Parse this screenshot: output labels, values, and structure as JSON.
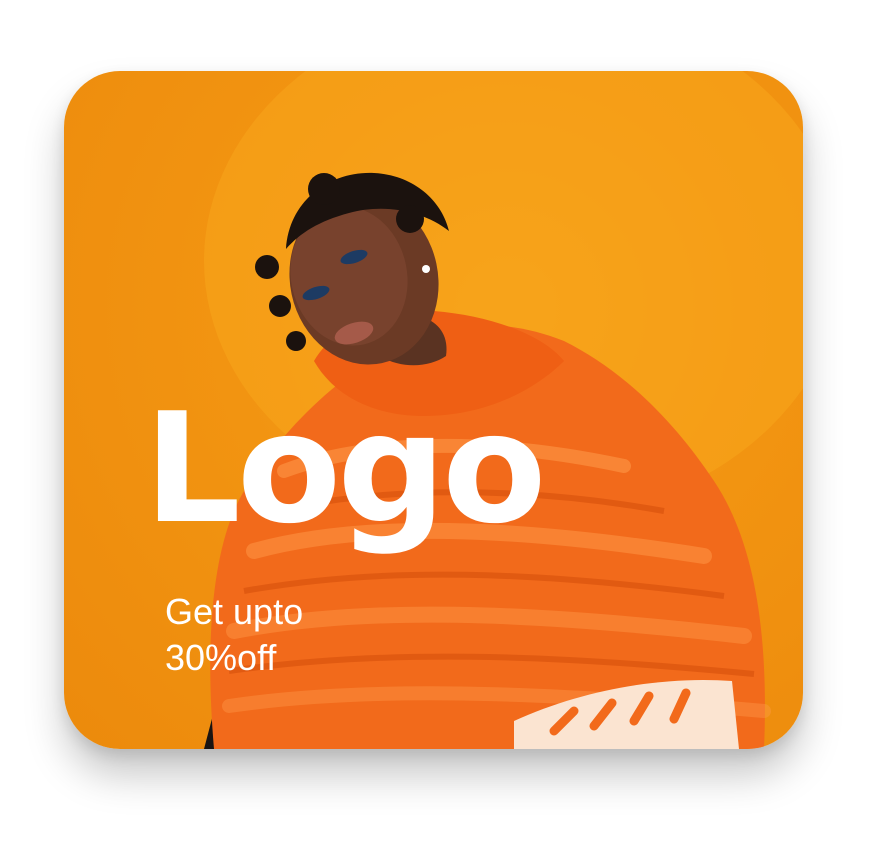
{
  "card": {
    "logo_text": "Logo",
    "promo_line_1": "Get upto",
    "promo_line_2": "30%off"
  },
  "colors": {
    "background": "#f29411",
    "jacket": "#f26a1b",
    "text": "#ffffff"
  },
  "image": {
    "subject": "model-in-orange-puffer-jacket"
  }
}
